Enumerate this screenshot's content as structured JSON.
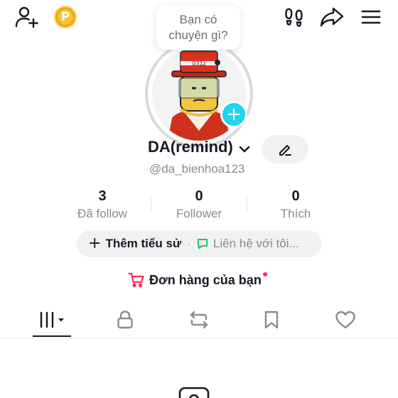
{
  "header": {
    "add_friend_icon": "add-friend-icon",
    "coin_label": "P",
    "footprints_icon": "footprints-icon",
    "share_icon": "share-arrow-icon",
    "menu_icon": "hamburger-menu-icon"
  },
  "note_bubble": {
    "text": "Bạn có chuyện gì?"
  },
  "profile": {
    "display_name": "DA(remind)",
    "handle": "@da_bienhoa123",
    "add_avatar_label": "+"
  },
  "stats": [
    {
      "value": "3",
      "label": "Đã follow"
    },
    {
      "value": "0",
      "label": "Follower"
    },
    {
      "value": "0",
      "label": "Thích"
    }
  ],
  "bio": {
    "add_bio_label": "Thêm tiểu sử",
    "separator": "·",
    "contact_label": "Liên hệ với tôi..."
  },
  "orders": {
    "label": "Đơn hàng của bạn"
  },
  "tabs": [
    {
      "icon": "videos-grid-icon",
      "active": true
    },
    {
      "icon": "lock-icon",
      "active": false
    },
    {
      "icon": "repost-icon",
      "active": false
    },
    {
      "icon": "bookmark-icon",
      "active": false
    },
    {
      "icon": "heart-icon",
      "active": false
    }
  ],
  "colors": {
    "accent_cyan": "#20d5ec",
    "accent_red": "#fe2c55",
    "coin_gold": "#f6c231",
    "text_primary": "#161823",
    "text_secondary": "#8a8b91"
  }
}
